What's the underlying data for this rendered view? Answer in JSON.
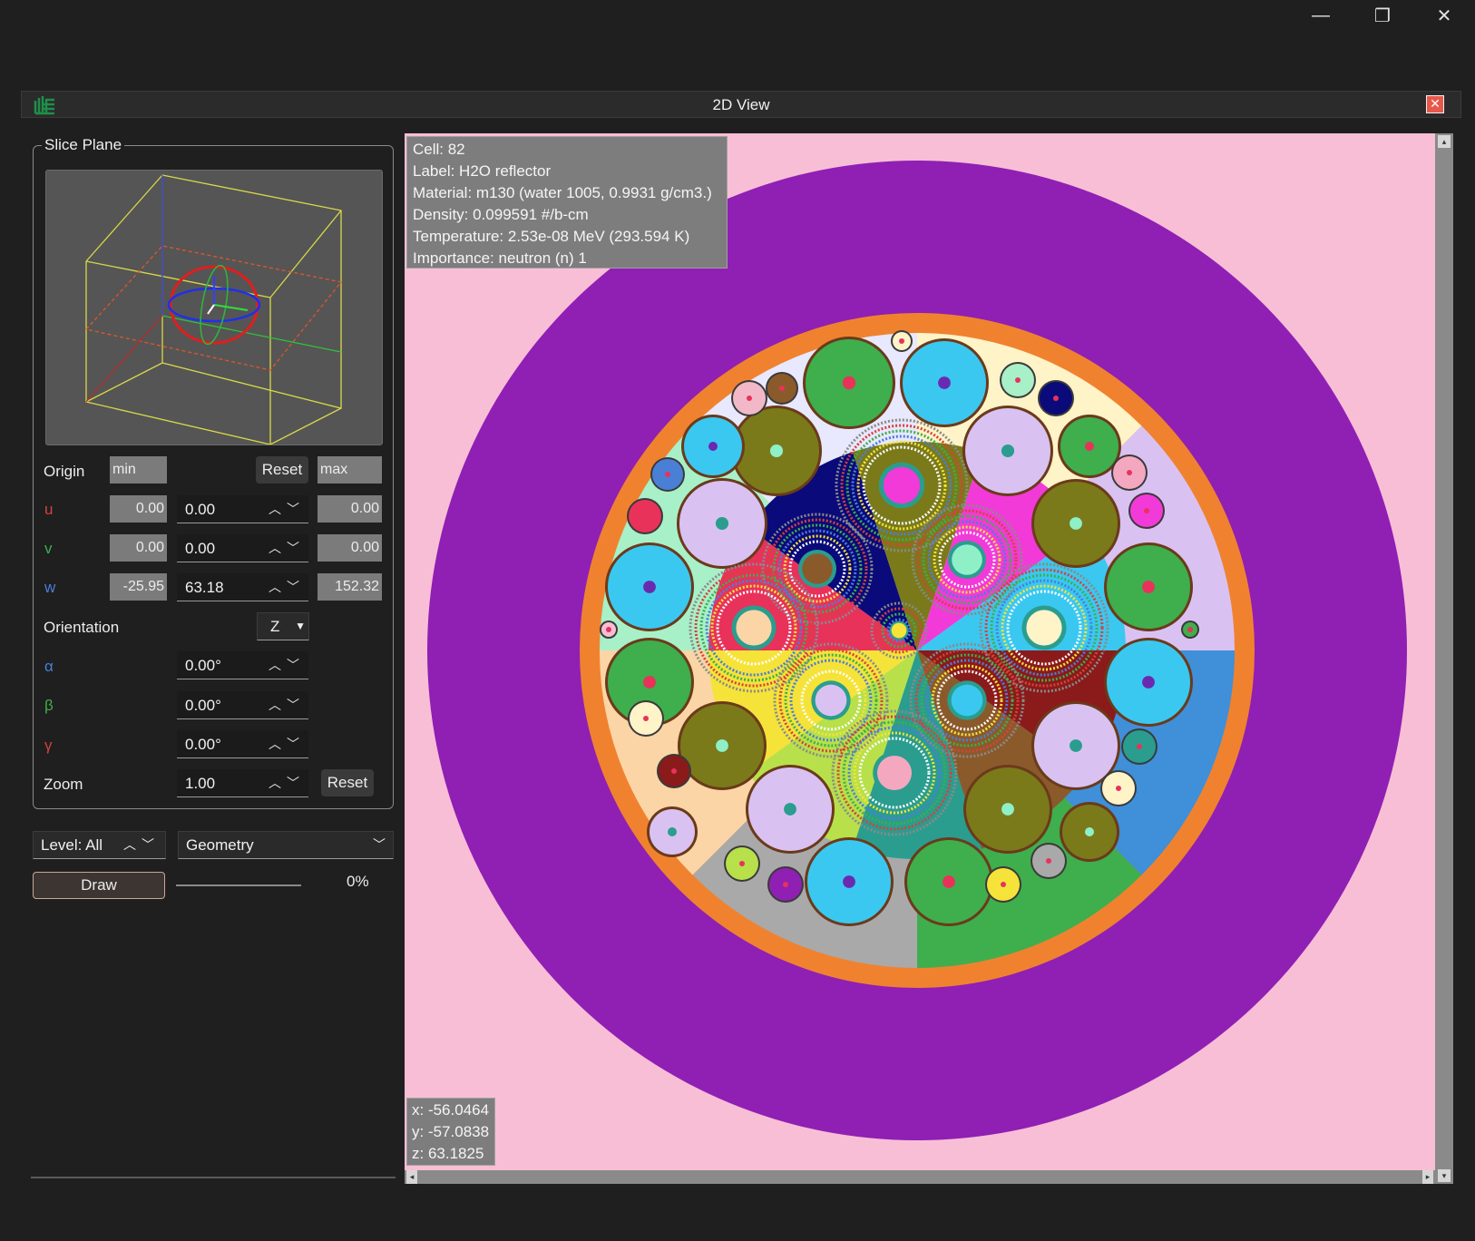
{
  "window": {
    "title": "2D View",
    "controls": [
      "minimize",
      "restore",
      "close"
    ]
  },
  "slice_plane": {
    "legend": "Slice Plane",
    "origin": {
      "label": "Origin",
      "min_placeholder": "min",
      "max_placeholder": "max",
      "reset": "Reset"
    },
    "u": {
      "label": "u",
      "min": "0.00",
      "value": "0.00",
      "max": "0.00"
    },
    "v": {
      "label": "v",
      "min": "0.00",
      "value": "0.00",
      "max": "0.00"
    },
    "w": {
      "label": "w",
      "min": "-25.95",
      "value": "63.18",
      "max": "152.32"
    },
    "orientation": {
      "label": "Orientation",
      "value": "Z"
    },
    "alpha": {
      "label": "α",
      "value": "0.00°"
    },
    "beta": {
      "label": "β",
      "value": "0.00°"
    },
    "gamma": {
      "label": "γ",
      "value": "0.00°"
    },
    "zoom": {
      "label": "Zoom",
      "value": "1.00",
      "reset": "Reset"
    }
  },
  "controls": {
    "level": "Level: All",
    "mode": "Geometry",
    "draw": "Draw",
    "progress_text": "0%"
  },
  "cell_info": {
    "cell": "Cell: 82",
    "label": "Label: H2O reflector",
    "material": "Material: m130 (water 1005, 0.9931 g/cm3.)",
    "density": "Density: 0.099591 #/b-cm",
    "temperature": "Temperature: 2.53e-08 MeV (293.594 K)",
    "importance": "Importance: neutron (n) 1"
  },
  "cursor": {
    "x": "x: -56.0464",
    "y": "y: -57.0838",
    "z": "z: 63.1825"
  },
  "colors": {
    "background": "#f8bed6",
    "reflector": "#901fb4",
    "vessel": "#f0822f",
    "accent_red": "#d4433a",
    "accent_green": "#3fae4d",
    "accent_blue": "#4a7fd6"
  }
}
